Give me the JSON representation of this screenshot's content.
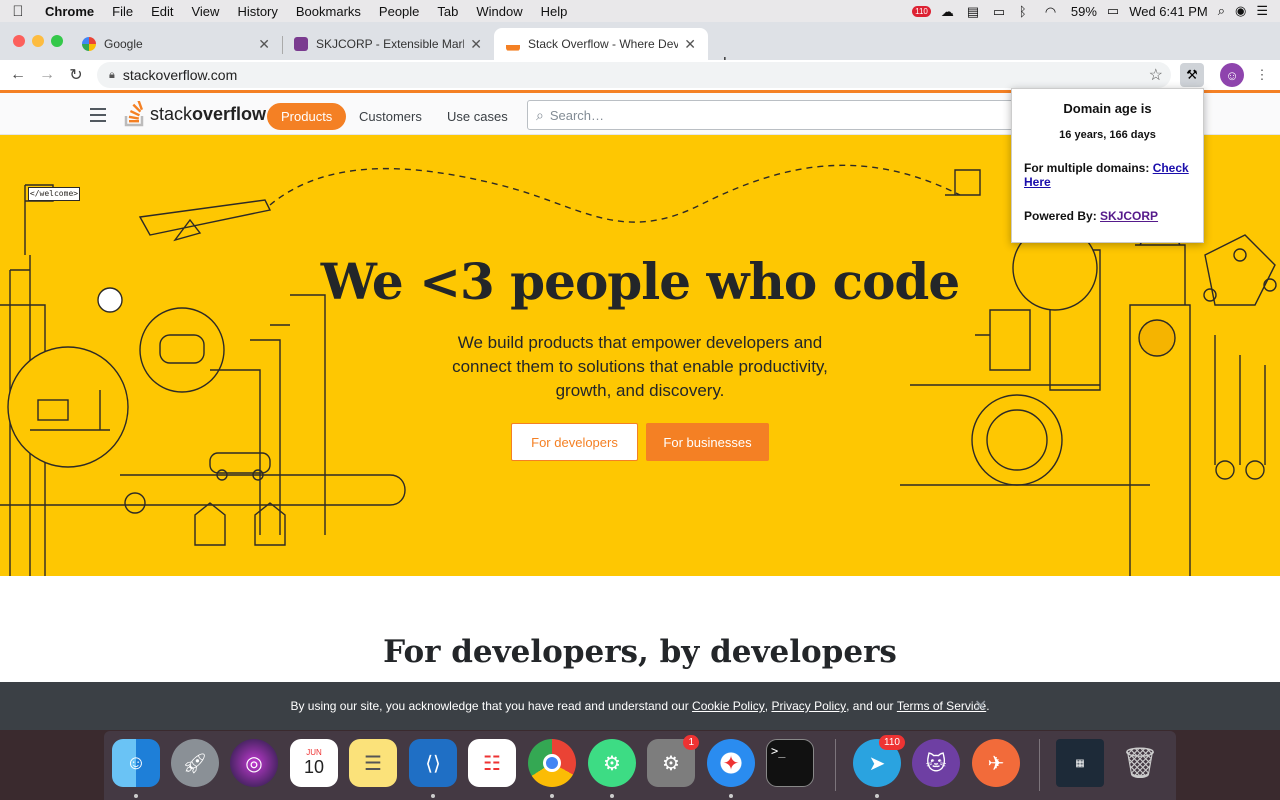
{
  "menubar": {
    "app": "Chrome",
    "items": [
      "File",
      "Edit",
      "View",
      "History",
      "Bookmarks",
      "People",
      "Tab",
      "Window",
      "Help"
    ],
    "badge": "110",
    "battery": "59%",
    "clock": "Wed 6:41 PM"
  },
  "tabs": [
    {
      "title": "Google"
    },
    {
      "title": "SKJCORP - Extensible Markup"
    },
    {
      "title": "Stack Overflow - Where Develo"
    }
  ],
  "toolbar": {
    "url": "stackoverflow.com"
  },
  "site": {
    "logo_light": "stack",
    "logo_bold": "overflow",
    "nav": [
      "Products",
      "Customers",
      "Use cases"
    ],
    "search_placeholder": "Search…",
    "hero_title": "We <3 people who code",
    "hero_sub": "We build products that empower developers and connect them to solutions that enable productivity, growth, and discovery.",
    "btn_dev": "For developers",
    "btn_biz": "For businesses",
    "section_title": "For developers, by developers",
    "sign_text": "</welcome>"
  },
  "popup": {
    "title": "Domain age is",
    "age": "16 years, 166 days",
    "multi_label": "For multiple domains:",
    "multi_link": "Check Here",
    "powered_label": "Powered By:",
    "powered_link": "SKJCORP"
  },
  "cookie": {
    "prefix": "By using our site, you acknowledge that you have read and understand our",
    "cookie_link": "Cookie Policy",
    "sep1": ",",
    "privacy_link": "Privacy Policy",
    "mid": ", and our",
    "terms_link": "Terms of Service",
    "end": "."
  },
  "dock": {
    "calendar_month": "JUN",
    "calendar_day": "10",
    "prefs_badge": "1",
    "telegram_badge": "110"
  },
  "colors": {
    "hero": "#fec702",
    "accent": "#f48024",
    "banner": "#3b4045"
  }
}
